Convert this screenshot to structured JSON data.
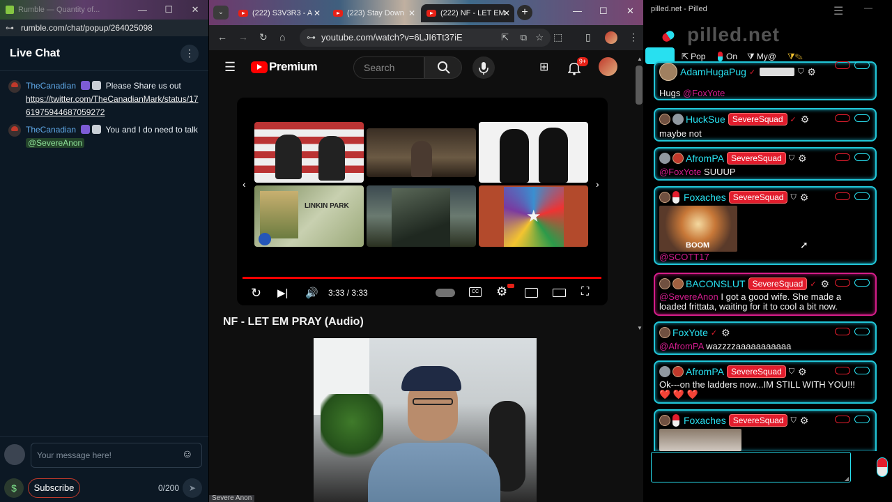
{
  "rumble": {
    "window_title": "Rumble — Quantity of...",
    "url": "rumble.com/chat/popup/264025098",
    "chat_title": "Live Chat",
    "messages": [
      {
        "user": "TheCanadian",
        "text": "Please Share us out",
        "link": "https://twitter.com/TheCanadianMark/status/1761975944687059272"
      },
      {
        "user": "TheCanadian",
        "text": "You and I do need to talk",
        "mention": "@SevereAnon"
      }
    ],
    "composer_placeholder": "Your message here!",
    "subscribe_label": "Subscribe",
    "char_count": "0/200"
  },
  "chrome": {
    "tabs": [
      {
        "label": "(222) S3V3R3 - A"
      },
      {
        "label": "(223) Stay Down"
      },
      {
        "label": "(222) NF - LET EM"
      }
    ],
    "url": "youtube.com/watch?v=6LJI6Tt37iE",
    "youtube": {
      "logo_text": "Premium",
      "search_placeholder": "Search",
      "notif_count": "9+",
      "time": "3:33 / 3:33",
      "video_title": "NF - LET EM PRAY (Audio)",
      "status_text": "Severe Anon",
      "thumb_labels": {
        "lp_title": "LINKIN PARK",
        "boom": "BOOM"
      }
    }
  },
  "pilled": {
    "window_title": "pilled.net - Pilled",
    "logo": "pilled.net",
    "toolbar": {
      "pop": "Pop",
      "on": "On",
      "my": "My@"
    },
    "messages": [
      {
        "user": "AdamHugaPug",
        "squad": "",
        "mention": "@FoxYote",
        "text": "Hugs"
      },
      {
        "user": "HuckSue",
        "squad": "SevereSquad",
        "text": "maybe not"
      },
      {
        "user": "AfromPA",
        "squad": "SevereSquad",
        "mention": "@FoxYote",
        "text": "SUUUP"
      },
      {
        "user": "Foxaches",
        "squad": "SevereSquad",
        "mention": "@SCOTT17",
        "image_caption": "BOOM"
      },
      {
        "user": "BACONSLUT",
        "squad": "SevereSquad",
        "mention": "@SevereAnon",
        "text": "I got a good wife. She made a loaded frittata, waiting for it to cool a bit now."
      },
      {
        "user": "FoxYote",
        "squad": "",
        "mention": "@AfromPA",
        "text": "wazzzzaaaaaaaaaaa"
      },
      {
        "user": "AfromPA",
        "squad": "SevereSquad",
        "text": "Ok---on the ladders now...IM STILL WITH YOU!!!",
        "hearts": "❤️ ❤️ ❤️"
      },
      {
        "user": "Foxaches",
        "squad": "SevereSquad"
      }
    ]
  },
  "colors": {
    "cyan": "#28e0f0",
    "squad_red": "#e21d2d",
    "yt_red": "#ff0000",
    "rumble_bg": "#0c1824"
  }
}
